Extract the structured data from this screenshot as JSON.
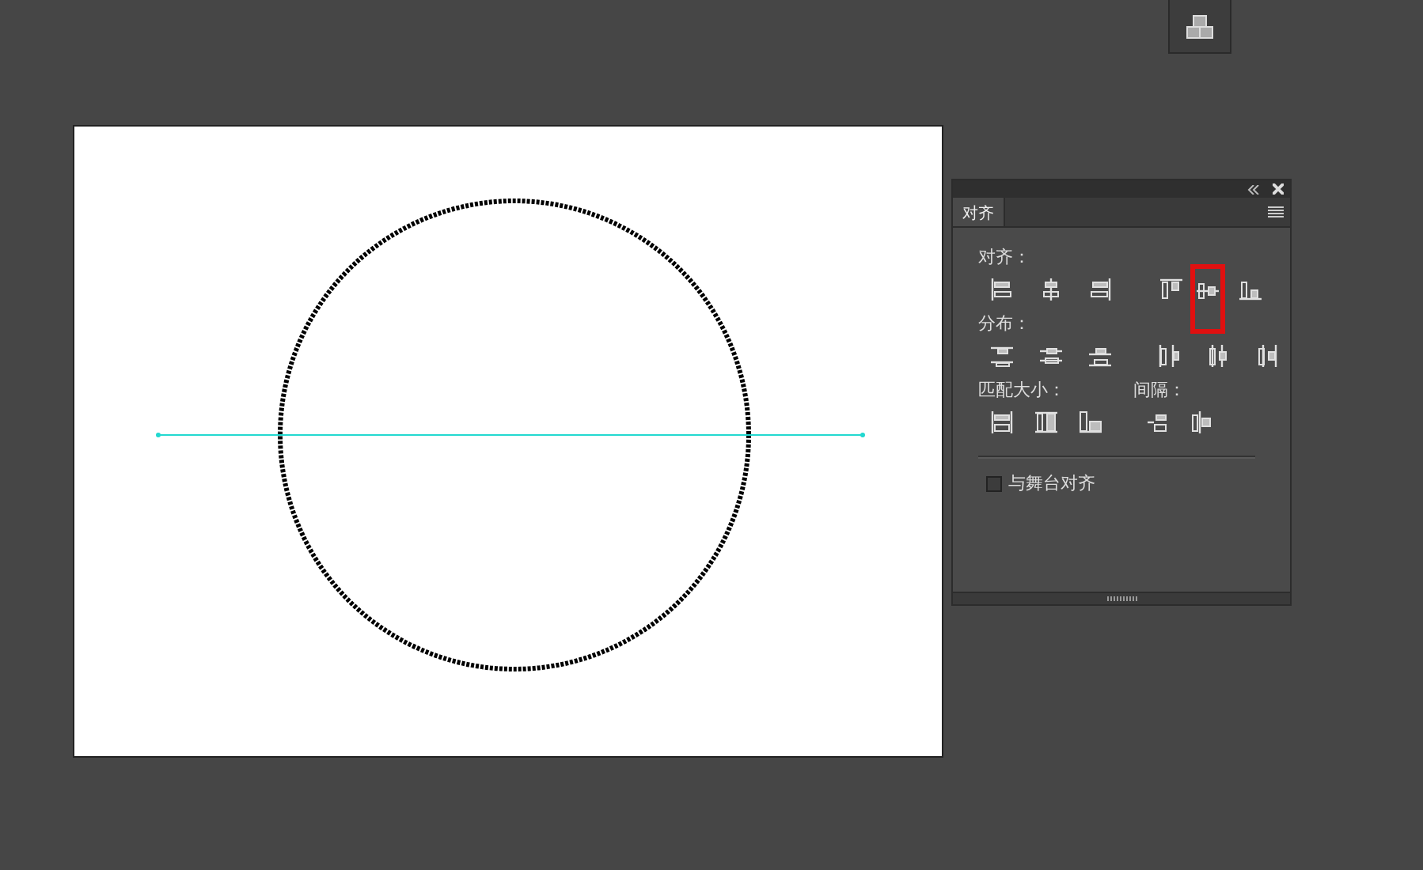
{
  "panel": {
    "tabs": [
      {
        "label": "对齐",
        "selected": true
      }
    ],
    "sections": [
      {
        "label": "对齐：",
        "buttons": [
          {
            "kind": "align-left",
            "highlighted": false
          },
          {
            "kind": "align-hcenter",
            "highlighted": false
          },
          {
            "kind": "align-right",
            "highlighted": false
          },
          {
            "kind": "align-top",
            "highlighted": false
          },
          {
            "kind": "align-vcenter",
            "highlighted": true
          },
          {
            "kind": "align-bottom",
            "highlighted": false
          }
        ]
      },
      {
        "label": "分布：",
        "buttons": [
          {
            "kind": "dist-top",
            "highlighted": false
          },
          {
            "kind": "dist-vcenter",
            "highlighted": false
          },
          {
            "kind": "dist-bottom",
            "highlighted": false
          },
          {
            "kind": "dist-left",
            "highlighted": false
          },
          {
            "kind": "dist-hcenter",
            "highlighted": false
          },
          {
            "kind": "dist-right",
            "highlighted": false
          }
        ]
      }
    ],
    "lower": [
      {
        "label": "匹配大小：",
        "buttons": [
          {
            "kind": "match-width",
            "highlighted": false
          },
          {
            "kind": "match-height",
            "highlighted": false
          },
          {
            "kind": "match-both",
            "highlighted": false
          }
        ]
      },
      {
        "label": "间隔：",
        "buttons": [
          {
            "kind": "space-v",
            "highlighted": false
          },
          {
            "kind": "space-h",
            "highlighted": false
          }
        ]
      }
    ],
    "stage_align": {
      "label": "与舞台对齐",
      "checked": false
    }
  }
}
